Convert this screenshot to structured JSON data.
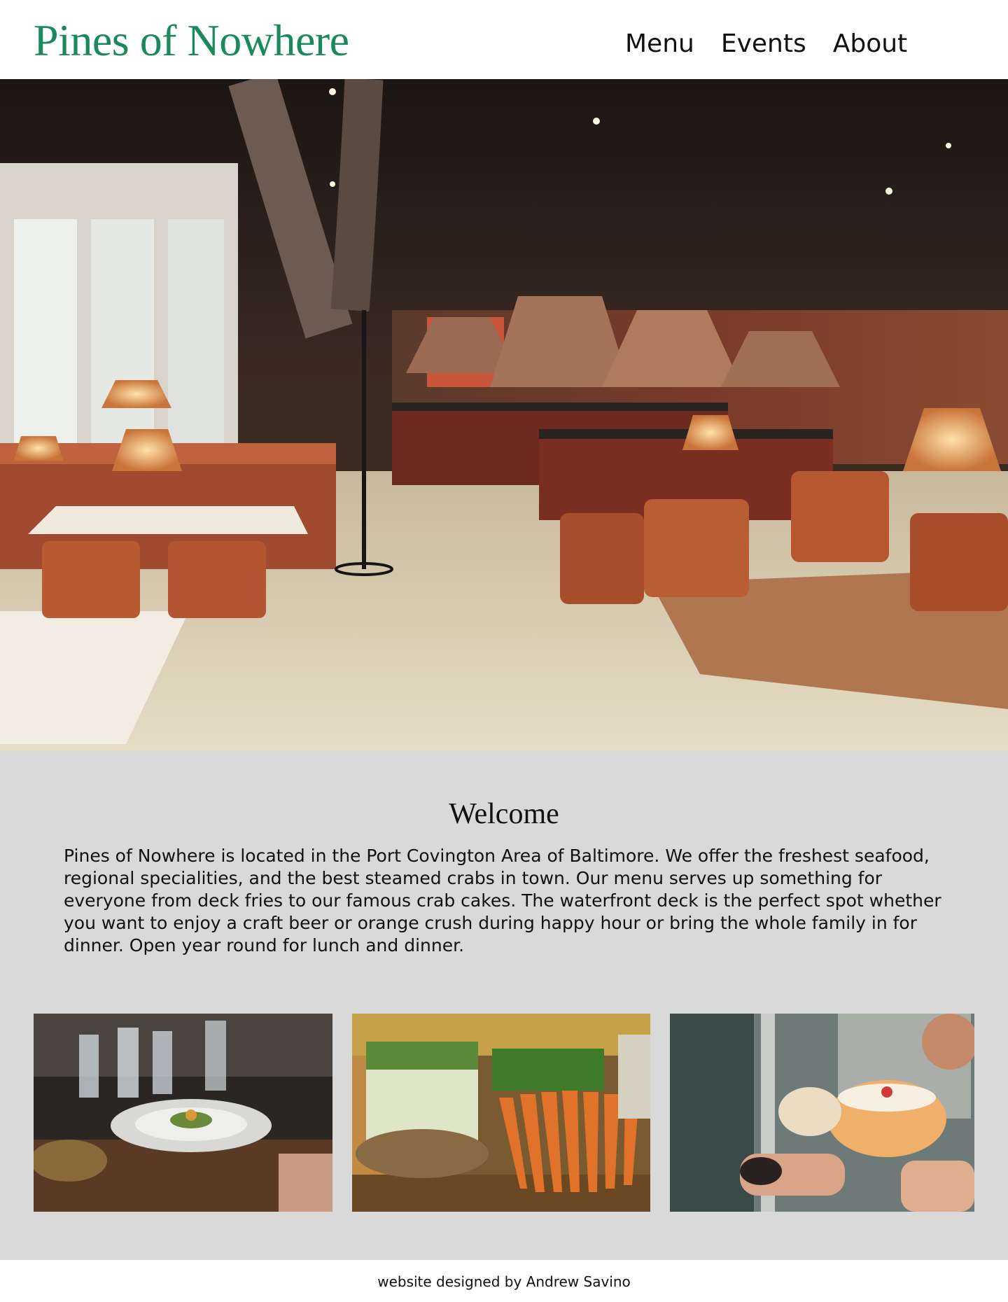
{
  "header": {
    "logo": "Pines of Nowhere",
    "nav": [
      {
        "label": "Menu"
      },
      {
        "label": "Events"
      },
      {
        "label": "About"
      }
    ]
  },
  "welcome": {
    "title": "Welcome",
    "text": "Pines of Nowhere is located in the Port Covington Area of Baltimore. We offer the freshest seafood, regional specialities, and the best steamed crabs in town. Our menu serves up something for everyone from deck fries to our famous crab cakes. The waterfront deck is the perfect spot whether you want to enjoy a craft beer or orange crush during happy hour or bring the whole family in for dinner. Open year round for lunch and dinner."
  },
  "footer": {
    "text": "website designed by Andrew Savino"
  },
  "colors": {
    "brand_green": "#1a8a5c",
    "section_bg": "#d9d9d9"
  }
}
